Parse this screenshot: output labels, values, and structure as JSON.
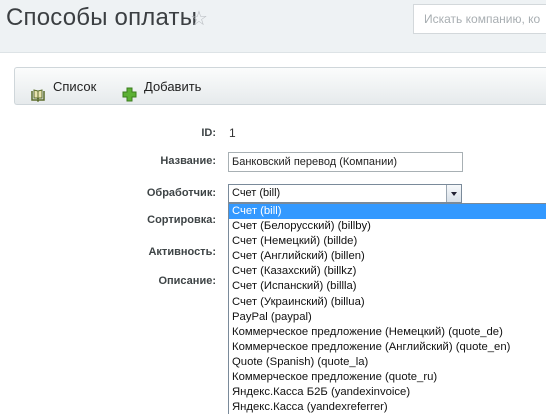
{
  "header": {
    "title": "Способы оплаты",
    "search_placeholder": "Искать компанию, ко"
  },
  "toolbar": {
    "list_label": "Список",
    "add_label": "Добавить"
  },
  "form": {
    "id_label": "ID:",
    "id_value": "1",
    "name_label": "Название:",
    "name_value": "Банковский перевод (Компании)",
    "handler_label": "Обработчик:",
    "handler_value": "Счет (bill)",
    "sort_label": "Сортировка:",
    "active_label": "Активность:",
    "desc_label": "Описание:"
  },
  "dropdown": {
    "items": [
      "Счет (bill)",
      "Счет (Белорусский) (billby)",
      "Счет (Немецкий) (billde)",
      "Счет (Английский) (billen)",
      "Счет (Казахский) (billkz)",
      "Счет (Испанский) (billla)",
      "Счет (Украинский) (billua)",
      "PayPal (paypal)",
      "Коммерческое предложение (Немецкий) (quote_de)",
      "Коммерческое предложение (Английский) (quote_en)",
      "Quote (Spanish) (quote_la)",
      "Коммерческое предложение (quote_ru)",
      "Яндекс.Касса Б2Б (yandexinvoice)",
      "Яндекс.Касса (yandexreferrer)"
    ],
    "selected_index": 0
  },
  "colors": {
    "selected_bg": "#3399ff",
    "page_bg": "#eef2f4",
    "add_icon": "#4a9e2a"
  }
}
